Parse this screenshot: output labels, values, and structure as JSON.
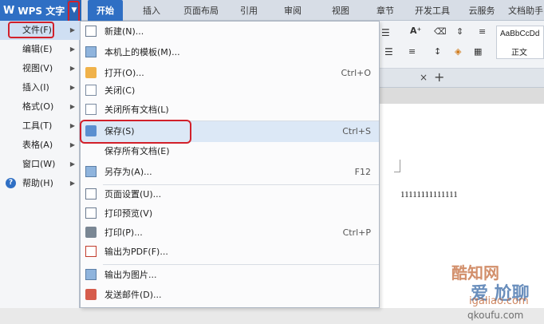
{
  "app": {
    "logo": "W",
    "title": "WPS 文字",
    "menu_arrow": "▼"
  },
  "tabs": [
    {
      "label": "开始",
      "active": true
    },
    {
      "label": "插入"
    },
    {
      "label": "页面布局"
    },
    {
      "label": "引用"
    },
    {
      "label": "审阅"
    },
    {
      "label": "视图"
    },
    {
      "label": "章节"
    },
    {
      "label": "开发工具"
    },
    {
      "label": "云服务"
    },
    {
      "label": "文档助手"
    }
  ],
  "ribbon": {
    "font_grow": "A⁺",
    "style_sample": "AaBbCcDd",
    "style_name": "正文"
  },
  "doc_tabs": {
    "close": "×",
    "add": "+"
  },
  "left_menu": [
    {
      "label": "文件(F)",
      "active": true
    },
    {
      "label": "编辑(E)"
    },
    {
      "label": "视图(V)"
    },
    {
      "label": "插入(I)"
    },
    {
      "label": "格式(O)"
    },
    {
      "label": "工具(T)"
    },
    {
      "label": "表格(A)"
    },
    {
      "label": "窗口(W)"
    },
    {
      "label": "帮助(H)"
    }
  ],
  "file_menu": [
    {
      "label": "新建(N)...",
      "shortcut": ""
    },
    {
      "label": "本机上的模板(M)...",
      "shortcut": ""
    },
    {
      "label": "打开(O)...",
      "shortcut": "Ctrl+O"
    },
    {
      "label": "关闭(C)",
      "shortcut": ""
    },
    {
      "label": "关闭所有文档(L)",
      "shortcut": ""
    },
    {
      "label": "保存(S)",
      "shortcut": "Ctrl+S"
    },
    {
      "label": "保存所有文档(E)",
      "shortcut": ""
    },
    {
      "label": "另存为(A)...",
      "shortcut": "F12"
    },
    {
      "label": "页面设置(U)...",
      "shortcut": ""
    },
    {
      "label": "打印预览(V)",
      "shortcut": ""
    },
    {
      "label": "打印(P)...",
      "shortcut": "Ctrl+P"
    },
    {
      "label": "输出为PDF(F)...",
      "shortcut": ""
    },
    {
      "label": "输出为图片...",
      "shortcut": ""
    },
    {
      "label": "发送邮件(D)...",
      "shortcut": ""
    }
  ],
  "document": {
    "text": "11111111111111"
  },
  "watermark": {
    "line1": "酷知网",
    "line2": "爱 尬聊",
    "line3": "igaliao.com",
    "line4": "qkoufu.com"
  },
  "colors": {
    "accent": "#2f6fc4",
    "highlight": "#d2202a",
    "hover": "#dce8f6"
  }
}
